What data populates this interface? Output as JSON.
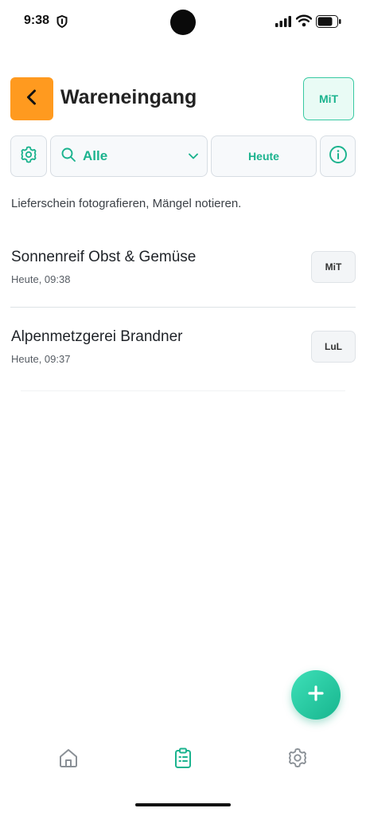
{
  "status_bar": {
    "time": "9:38"
  },
  "header": {
    "title": "Wareneingang",
    "user_badge": "MiT"
  },
  "filters": {
    "category": "Alle",
    "date": "Heute"
  },
  "hint_text": "Lieferschein fotografieren, Mängel notieren.",
  "entries": [
    {
      "supplier": "Sonnenreif Obst & Gemüse",
      "time": "Heute, 09:38",
      "user": "MiT"
    },
    {
      "supplier": "Alpenmetzgerei Brandner",
      "time": "Heute, 09:37",
      "user": "LuL"
    }
  ],
  "colors": {
    "accent": "#1bb38e",
    "back_button": "#ff9a1f"
  },
  "icons": {
    "back": "chevron-left-icon",
    "settings": "gear-icon",
    "search": "search-icon",
    "dropdown": "chevron-down-icon",
    "info": "info-icon",
    "add": "plus-icon",
    "home": "home-icon",
    "list": "clipboard-list-icon"
  }
}
